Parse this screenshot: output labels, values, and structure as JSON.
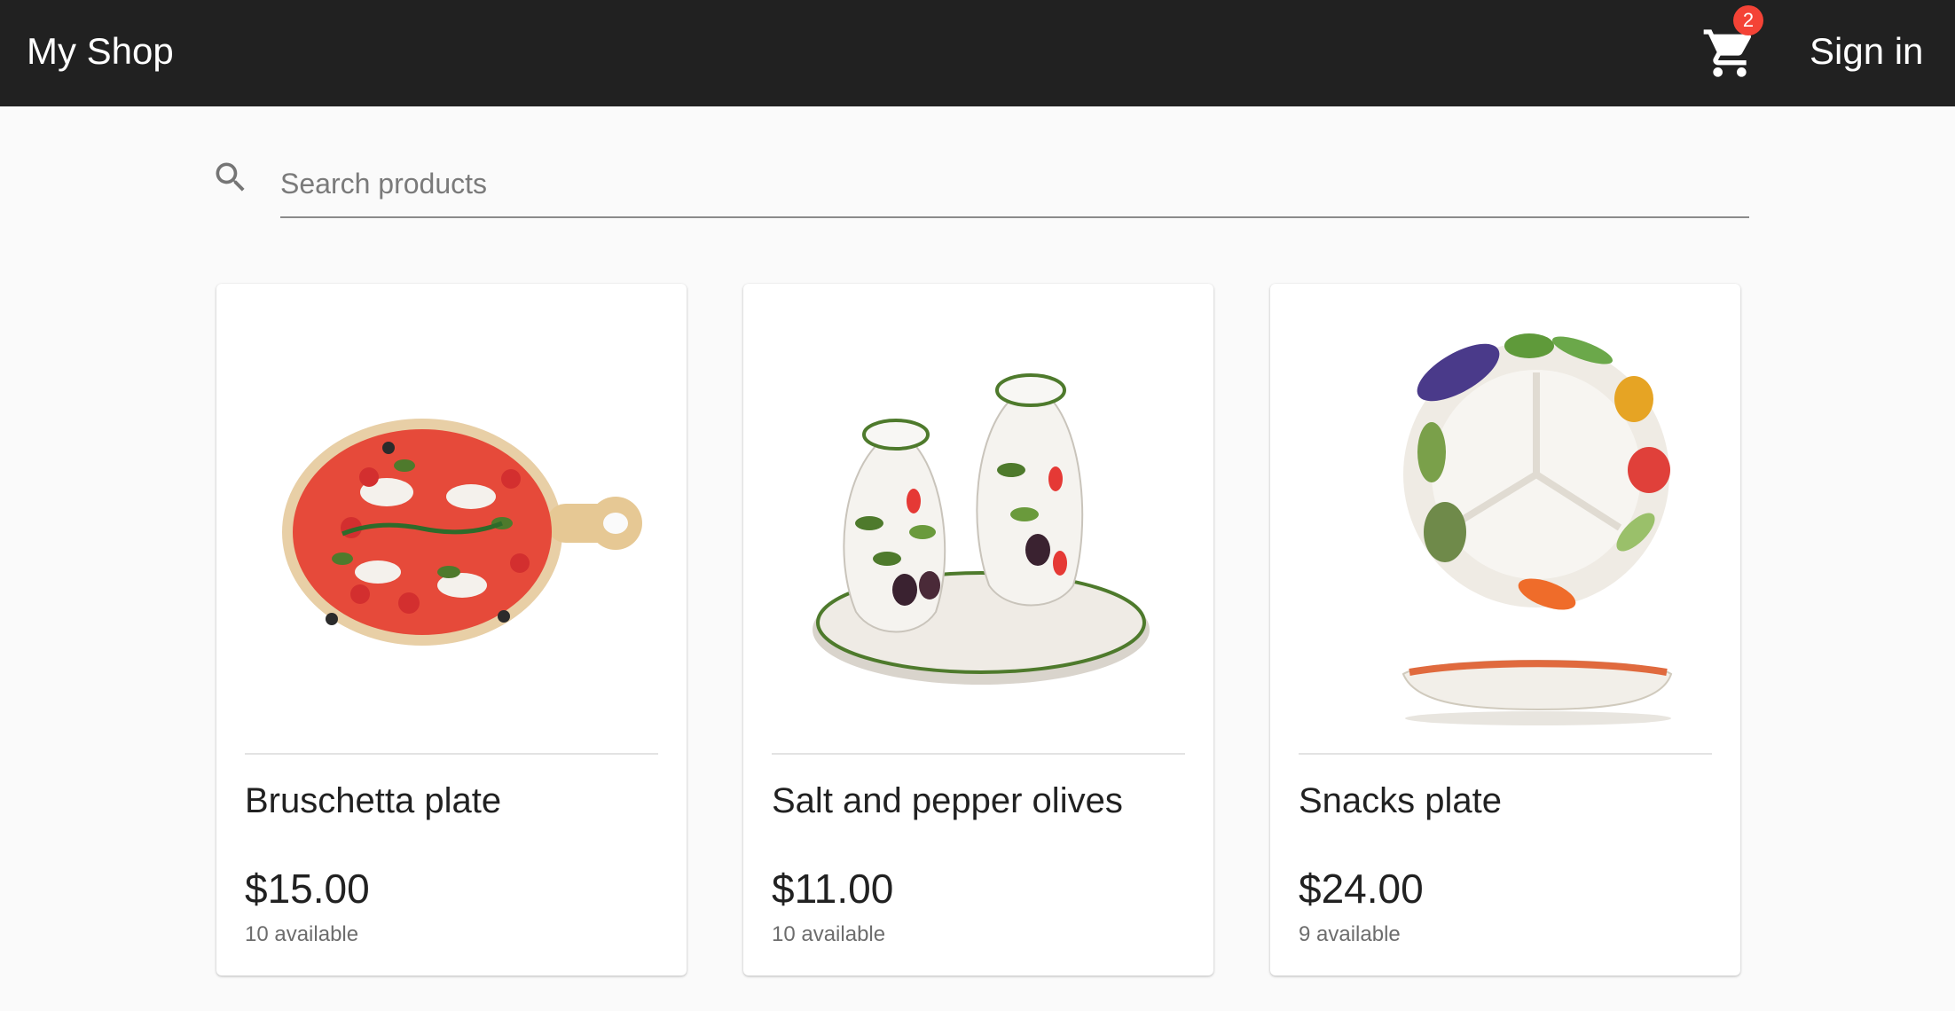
{
  "header": {
    "brand": "My Shop",
    "cart_count": "2",
    "sign_in_label": "Sign in"
  },
  "search": {
    "placeholder": "Search products",
    "value": ""
  },
  "products": [
    {
      "name": "Bruschetta plate",
      "price": "$15.00",
      "stock": "10 available",
      "image": "bruschetta-plate-image"
    },
    {
      "name": "Salt and pepper olives",
      "price": "$11.00",
      "stock": "10 available",
      "image": "salt-pepper-olives-image"
    },
    {
      "name": "Snacks plate",
      "price": "$24.00",
      "stock": "9 available",
      "image": "snacks-plate-image"
    }
  ],
  "colors": {
    "topbar": "#212121",
    "background": "#fafafa",
    "badge": "#f44336"
  }
}
